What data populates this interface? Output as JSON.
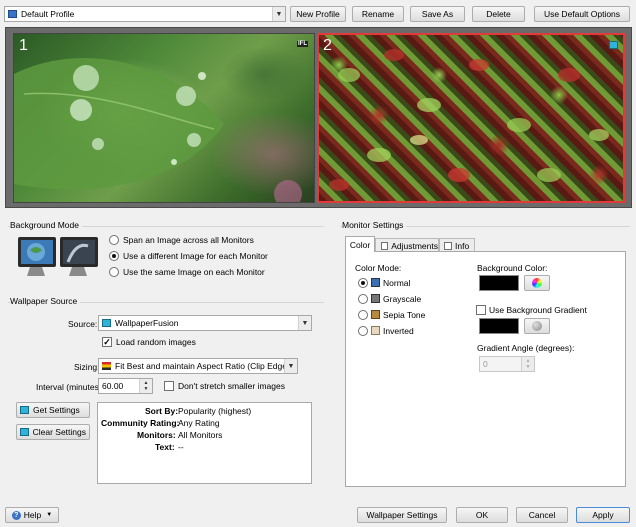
{
  "toolbar": {
    "profile_value": "Default Profile",
    "new_profile": "New Profile",
    "rename": "Rename",
    "save_as": "Save As",
    "delete": "Delete",
    "use_default_options": "Use Default Options"
  },
  "monitors": [
    {
      "number": "1",
      "badge": "IFL"
    },
    {
      "number": "2",
      "badge": ""
    }
  ],
  "background_mode": {
    "title": "Background Mode",
    "options": [
      "Span an Image across all Monitors",
      "Use a different Image for each Monitor",
      "Use the same Image on each Monitor"
    ],
    "selected_index": 1
  },
  "wallpaper_source": {
    "title": "Wallpaper Source",
    "source_label": "Source:",
    "source_value": "WallpaperFusion",
    "load_random_label": "Load random images",
    "load_random_checked": true,
    "sizing_label": "Sizing:",
    "sizing_value": "Fit Best and maintain Aspect Ratio (Clip Edges)",
    "interval_label": "Interval (minutes):",
    "interval_value": "60.00",
    "dont_stretch_label": "Don't stretch smaller images",
    "dont_stretch_checked": false,
    "get_settings": "Get Settings",
    "clear_settings": "Clear Settings",
    "info_rows": [
      {
        "key": "Sort By:",
        "value": "Popularity (highest)"
      },
      {
        "key": "Community Rating:",
        "value": "Any Rating"
      },
      {
        "key": "Monitors:",
        "value": "All Monitors"
      },
      {
        "key": "Text:",
        "value": "--"
      }
    ]
  },
  "monitor_settings": {
    "title": "Monitor Settings",
    "tabs": [
      "Color",
      "Adjustments",
      "Info"
    ],
    "active_tab": "Color",
    "color_mode_label": "Color Mode:",
    "color_modes": [
      "Normal",
      "Grayscale",
      "Sepia Tone",
      "Inverted"
    ],
    "color_mode_selected": 0,
    "background_color_label": "Background Color:",
    "use_gradient_label": "Use Background Gradient",
    "use_gradient_checked": false,
    "gradient_angle_label": "Gradient Angle (degrees):",
    "gradient_angle_value": "0"
  },
  "footer": {
    "help": "Help",
    "wallpaper_settings": "Wallpaper Settings",
    "ok": "OK",
    "cancel": "Cancel",
    "apply": "Apply"
  },
  "colors": {
    "background_color_swatch": "#000000",
    "gradient_color_swatch": "#000000",
    "monitor2_border": "#e23a3a",
    "preview_frame": "#6b6b6b"
  }
}
